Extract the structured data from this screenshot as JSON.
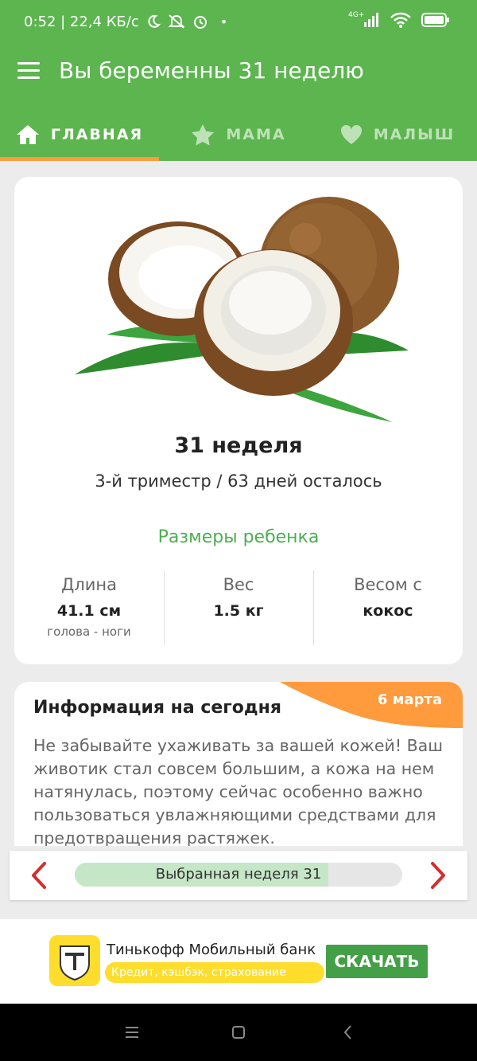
{
  "status_bar": {
    "time_speed": "0:52 | 22,4 КБ/с",
    "network": "4G+"
  },
  "app_bar": {
    "title": "Вы беременны 31 неделю"
  },
  "tabs": [
    {
      "label": "ГЛАВНАЯ",
      "icon": "home-icon",
      "active": true
    },
    {
      "label": "МАМА",
      "icon": "star-icon",
      "active": false
    },
    {
      "label": "МАЛЫШ",
      "icon": "heart-icon",
      "active": false
    }
  ],
  "week_card": {
    "image": "coconut",
    "title": "31 неделя",
    "subtitle": "3-й триместр / 63 дней осталось",
    "sizes_title": "Размеры ребенка",
    "metrics": [
      {
        "label": "Длина",
        "value": "41.1 см",
        "note": "голова - ноги"
      },
      {
        "label": "Вес",
        "value": "1.5 кг",
        "note": ""
      },
      {
        "label": "Весом с",
        "value": "кокос",
        "note": ""
      }
    ]
  },
  "info_card": {
    "title": "Информация на сегодня",
    "date": "6 марта",
    "body": "Не забывайте ухаживать за вашей кожей! Ваш животик стал совсем большим, а кожа на нем натянулась, поэтому сейчас особенно важно пользоваться увлажняющими средствами для предотвращения растяжек."
  },
  "week_selector": {
    "label": "Выбранная неделя 31",
    "progress": 0.775
  },
  "ad": {
    "title": "Тинькофф Мобильный банк",
    "subtitle": "Кредит, кэшбэк, страхование",
    "button": "СКАЧАТЬ"
  },
  "colors": {
    "primary": "#5cb54e",
    "accent": "#ff9a3d",
    "link_green": "#4caf50",
    "arrow_red": "#d32f2f",
    "ad_yellow": "#ffdd2d"
  }
}
